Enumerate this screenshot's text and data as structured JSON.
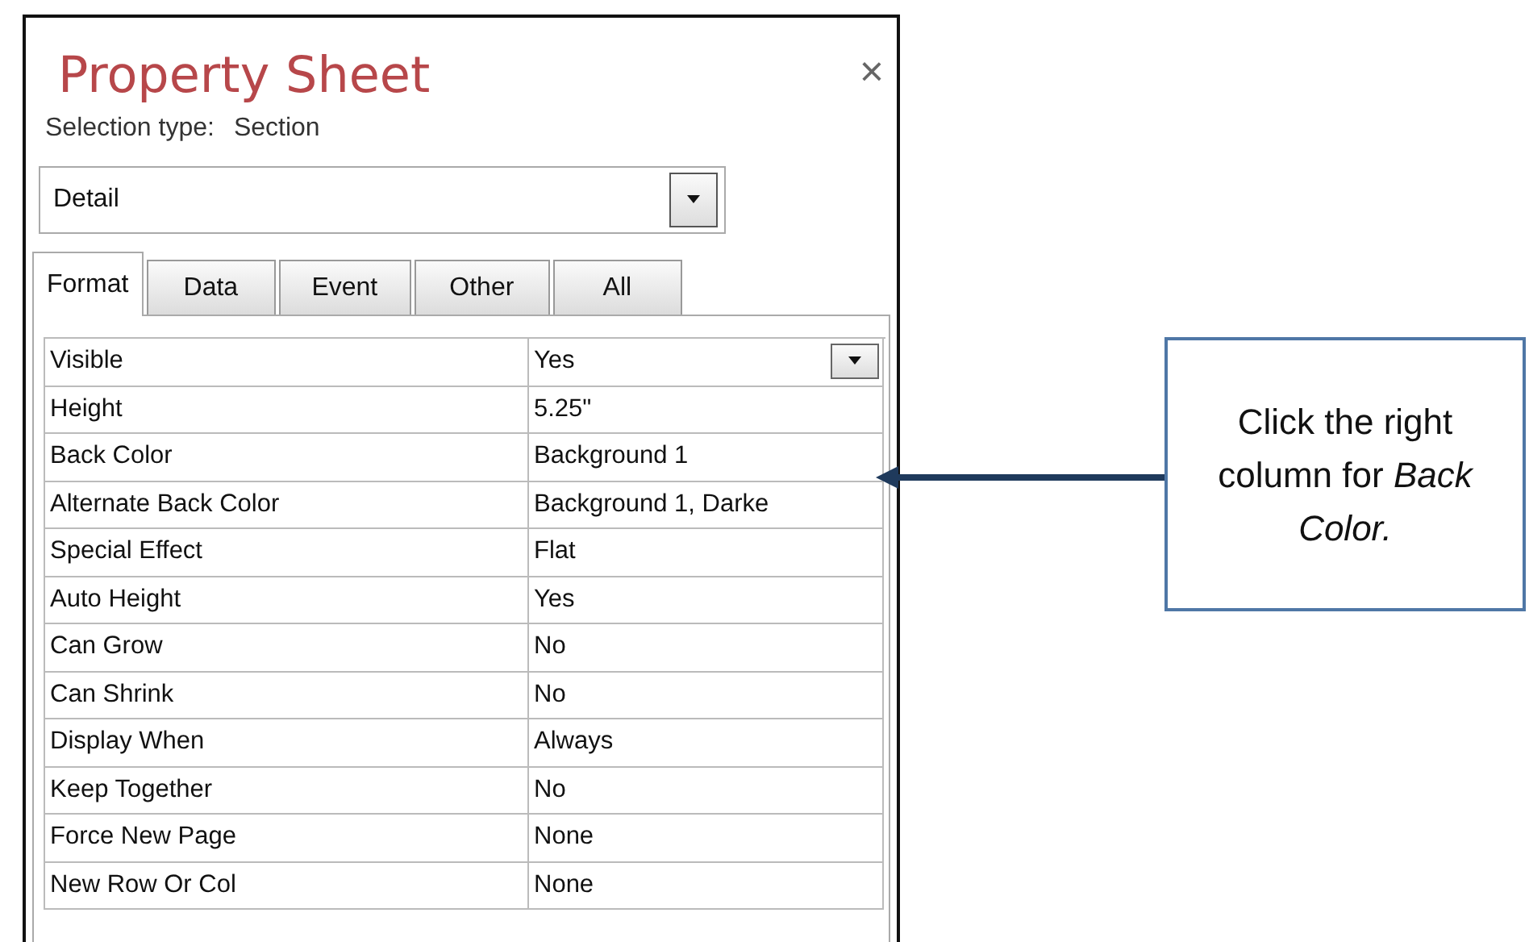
{
  "panel": {
    "title": "Property Sheet",
    "close": "×",
    "selection_type": {
      "label": "Selection type:",
      "value": "Section"
    },
    "selector": {
      "value": "Detail"
    }
  },
  "tabs": [
    {
      "label": "Format",
      "selected": true
    },
    {
      "label": "Data",
      "selected": false
    },
    {
      "label": "Event",
      "selected": false
    },
    {
      "label": "Other",
      "selected": false
    },
    {
      "label": "All",
      "selected": false
    }
  ],
  "properties": [
    {
      "name": "Visible",
      "value": "Yes",
      "has_dropdown": true
    },
    {
      "name": "Height",
      "value": "5.25\"",
      "has_dropdown": false
    },
    {
      "name": "Back Color",
      "value": "Background 1",
      "has_dropdown": false
    },
    {
      "name": "Alternate Back Color",
      "value": "Background 1, Darke",
      "has_dropdown": false
    },
    {
      "name": "Special Effect",
      "value": "Flat",
      "has_dropdown": false
    },
    {
      "name": "Auto Height",
      "value": "Yes",
      "has_dropdown": false
    },
    {
      "name": "Can Grow",
      "value": "No",
      "has_dropdown": false
    },
    {
      "name": "Can Shrink",
      "value": "No",
      "has_dropdown": false
    },
    {
      "name": "Display When",
      "value": "Always",
      "has_dropdown": false
    },
    {
      "name": "Keep Together",
      "value": "No",
      "has_dropdown": false
    },
    {
      "name": "Force New Page",
      "value": "None",
      "has_dropdown": false
    },
    {
      "name": "New Row Or Col",
      "value": "None",
      "has_dropdown": false
    }
  ],
  "callout": {
    "text": "Click the right column for *Back Color.*"
  }
}
